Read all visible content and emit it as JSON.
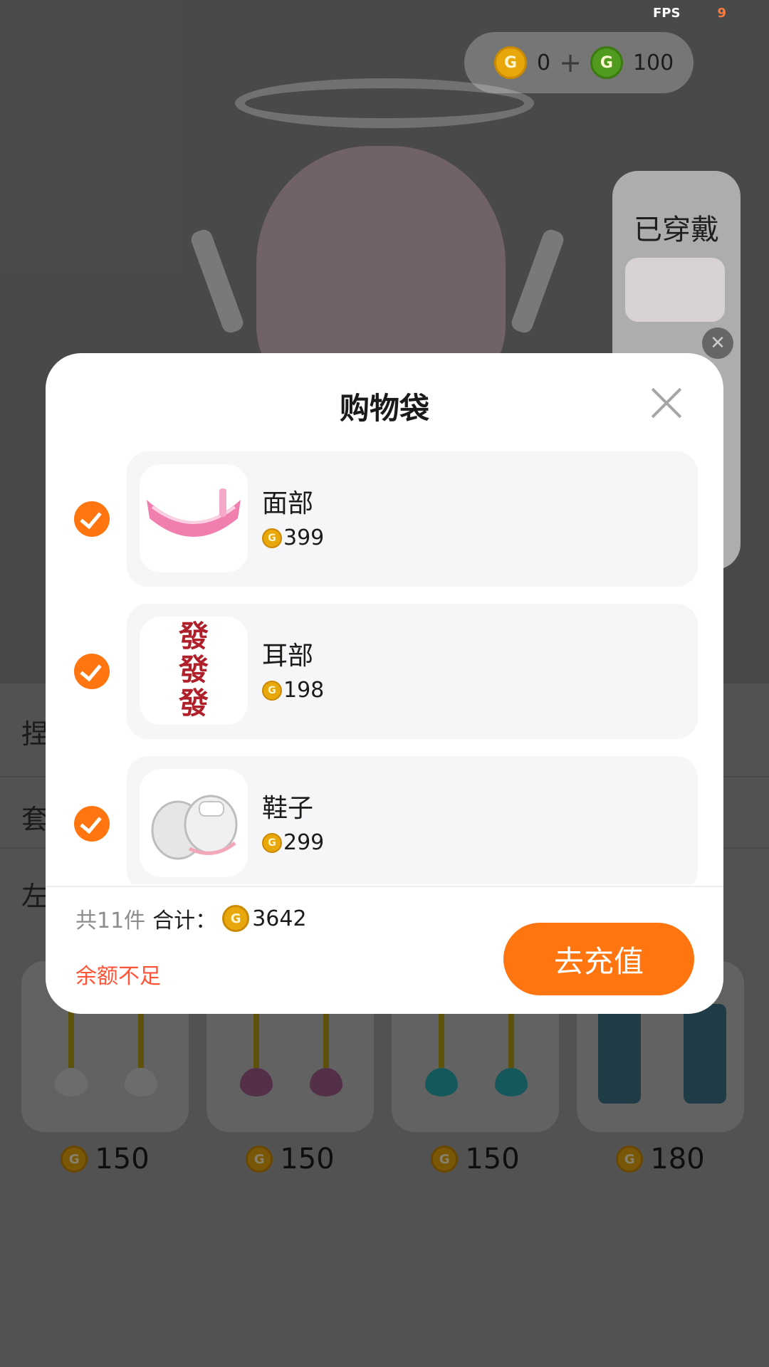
{
  "status": {
    "fps_label": "FPS",
    "fps_value": "9"
  },
  "currency": {
    "gold_amount": "0",
    "plus": "+",
    "green_amount": "100"
  },
  "worn_panel": {
    "title": "已穿戴"
  },
  "background_rows": {
    "row1": "捏",
    "row2": "套",
    "row3": "左"
  },
  "shop_items": [
    {
      "price": "150",
      "heart_color": "#cfcfcf"
    },
    {
      "price": "150",
      "heart_color": "#a05a8a"
    },
    {
      "price": "150",
      "heart_color": "#2aa9b0"
    },
    {
      "price": "180",
      "heart_color": "#3e7388"
    }
  ],
  "cart": {
    "title": "购物袋",
    "items": [
      {
        "name": "面部",
        "price": "399",
        "thumb": "pink-visor"
      },
      {
        "name": "耳部",
        "price": "198",
        "thumb": "red-characters",
        "thumb_text": "發\n發\n發"
      },
      {
        "name": "鞋子",
        "price": "299",
        "thumb": "white-slippers"
      }
    ],
    "count_text": "共11件",
    "total_label": "合计：",
    "total_value": "3642",
    "insufficient_text": "余额不足",
    "recharge_label": "去充值"
  },
  "colors": {
    "accent": "#ff7510",
    "warning": "#ff5436",
    "coin_gold": "#e8a80c",
    "coin_green": "#4f9a1f"
  }
}
